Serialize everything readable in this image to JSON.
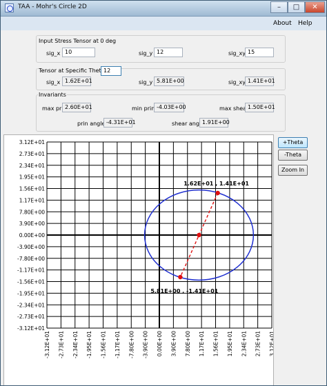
{
  "window": {
    "title": "TAA - Mohr's Circle 2D",
    "minimize": "–",
    "maximize": "□",
    "close": "✕"
  },
  "menu": {
    "about": "About",
    "help": "Help"
  },
  "input_group": {
    "label": "Input Stress Tensor at 0 deg",
    "sig_x_label": "sig_x",
    "sig_x": "10",
    "sig_y_label": "sig_y",
    "sig_y": "12",
    "sig_xy_label": "sig_xy",
    "sig_xy": "15"
  },
  "theta_group": {
    "label": "Tensor at Specific Theta =",
    "theta": "12",
    "sig_x_label": "sig_x",
    "sig_x": "1.62E+01",
    "sig_y_label": "sig_y",
    "sig_y": "5.81E+00",
    "sig_xy_label": "sig_xy",
    "sig_xy": "1.41E+01"
  },
  "invariants_group": {
    "label": "Invariants",
    "max_prin_label": "max prin",
    "max_prin": "2.60E+01",
    "min_prin_label": "min prin",
    "min_prin": "-4.03E+00",
    "max_shear_label": "max shear",
    "max_shear": "1.50E+01",
    "prin_angle_label": "prin angle",
    "prin_angle": "-4.31E+01",
    "shear_angle_label": "shear angle",
    "shear_angle": "1.91E+00"
  },
  "buttons": {
    "plus_theta": "+Theta",
    "minus_theta": "-Theta",
    "zoom_in": "Zoom In"
  },
  "chart_data": {
    "type": "scatter",
    "y_ticks": [
      "3.12E+01",
      "2.73E+01",
      "2.34E+01",
      "1.95E+01",
      "1.56E+01",
      "1.17E+01",
      "7.80E+00",
      "3.90E+00",
      "0.00E+00",
      "-3.90E+00",
      "-7.80E+00",
      "-1.17E+01",
      "-1.56E+01",
      "-1.95E+01",
      "-2.34E+01",
      "-2.73E+01",
      "-3.12E+01"
    ],
    "x_ticks": [
      "-3.12E+01",
      "-2.73E+01",
      "-2.34E+01",
      "-1.95E+01",
      "-1.56E+01",
      "-1.17E+01",
      "-7.80E+00",
      "-3.90E+00",
      "0.00E+00",
      "3.90E+00",
      "7.80E+00",
      "1.17E+01",
      "1.56E+01",
      "1.95E+01",
      "2.34E+01",
      "2.73E+01",
      "3.12E+01"
    ],
    "xlim": [
      -31.2,
      31.2
    ],
    "ylim": [
      -31.2,
      31.2
    ],
    "grid": true,
    "circle": {
      "center": [
        11,
        0
      ],
      "radius": 15.1,
      "color": "#1f2fd0"
    },
    "points": [
      {
        "x": 16.2,
        "y": 14.1,
        "label": "1.62E+01 , 1.41E+01"
      },
      {
        "x": 11,
        "y": 0,
        "label": ""
      },
      {
        "x": 5.81,
        "y": -14.1,
        "label": "5.81E+00 , -1.41E+01"
      }
    ],
    "diameter_color": "#e01010",
    "point_color": "#e01010"
  }
}
